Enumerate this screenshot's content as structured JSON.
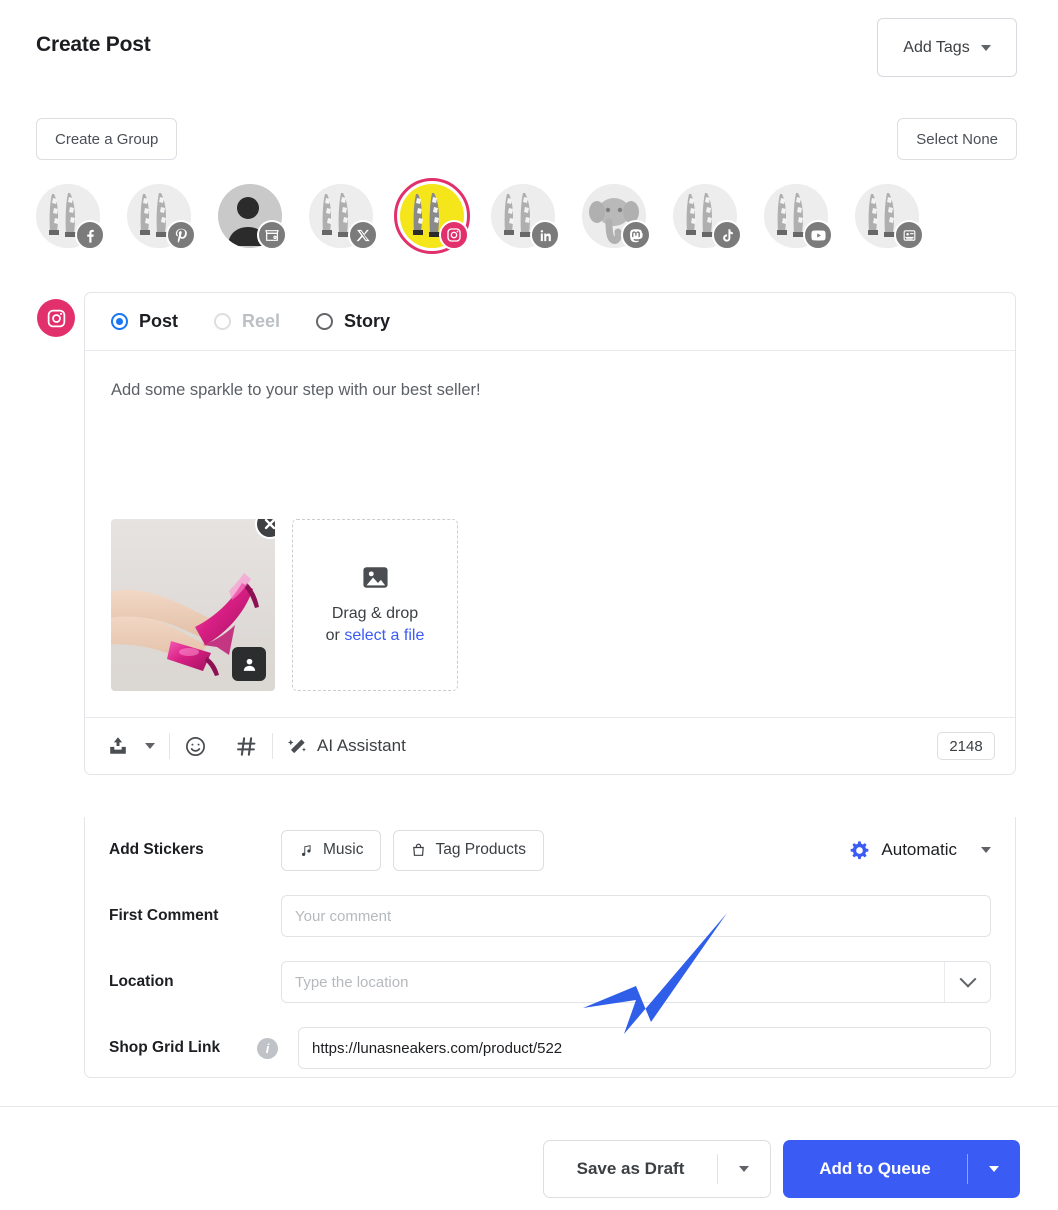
{
  "header": {
    "title": "Create Post",
    "add_tags_label": "Add Tags"
  },
  "group_bar": {
    "create_group_label": "Create a Group",
    "select_none_label": "Select None"
  },
  "accounts": [
    {
      "name": "facebook",
      "platform": "Facebook",
      "selected": false,
      "avatar": "sneaker"
    },
    {
      "name": "pinterest",
      "platform": "Pinterest",
      "selected": false,
      "avatar": "sneaker"
    },
    {
      "name": "google-business",
      "platform": "Google Business Profile",
      "selected": false,
      "avatar": "person"
    },
    {
      "name": "x-twitter",
      "platform": "X",
      "selected": false,
      "avatar": "sneaker"
    },
    {
      "name": "instagram",
      "platform": "Instagram",
      "selected": true,
      "avatar": "sneaker-color"
    },
    {
      "name": "linkedin",
      "platform": "LinkedIn",
      "selected": false,
      "avatar": "sneaker"
    },
    {
      "name": "mastodon",
      "platform": "Mastodon",
      "selected": false,
      "avatar": "elephant"
    },
    {
      "name": "tiktok",
      "platform": "TikTok",
      "selected": false,
      "avatar": "sneaker"
    },
    {
      "name": "youtube",
      "platform": "YouTube",
      "selected": false,
      "avatar": "sneaker"
    },
    {
      "name": "business-listing",
      "platform": "Business Listing",
      "selected": false,
      "avatar": "sneaker"
    }
  ],
  "composer": {
    "network": "Instagram",
    "post_types": [
      {
        "label": "Post",
        "selected": true,
        "disabled": false
      },
      {
        "label": "Reel",
        "selected": false,
        "disabled": true
      },
      {
        "label": "Story",
        "selected": false,
        "disabled": false
      }
    ],
    "caption": "Add some sparkle to your step with our best seller!",
    "media": {
      "alt": "Pink metallic high heel shoes on legs against light backdrop",
      "remove_label": "×",
      "tag_people_label": "Tag people"
    },
    "dropzone": {
      "line1": "Drag & drop",
      "line2_prefix": "or ",
      "line2_link": "select a file"
    },
    "toolbar": {
      "upload_label": "Upload",
      "emoji_label": "Emoji",
      "hashtag_label": "Hashtag",
      "ai_label": "AI Assistant",
      "char_count": "2148"
    }
  },
  "options": {
    "stickers_label": "Add Stickers",
    "music_label": "Music",
    "tag_products_label": "Tag Products",
    "automatic_label": "Automatic",
    "first_comment_label": "First Comment",
    "first_comment_placeholder": "Your comment",
    "first_comment_value": "",
    "location_label": "Location",
    "location_placeholder": "Type the location",
    "location_value": "",
    "shop_grid_label": "Shop Grid Link",
    "shop_grid_value": "https://lunasneakers.com/product/522",
    "shop_grid_info_glyph": "i"
  },
  "footer": {
    "save_draft_label": "Save as Draft",
    "add_to_queue_label": "Add to Queue"
  },
  "colors": {
    "primary_blue": "#3B5BF5",
    "instagram_pink": "#E1306C",
    "link_blue": "#3b5bf5",
    "radio_blue": "#1877F2",
    "gear_blue": "#3B5BF5",
    "annotation_arrow": "#2F5FE8"
  }
}
